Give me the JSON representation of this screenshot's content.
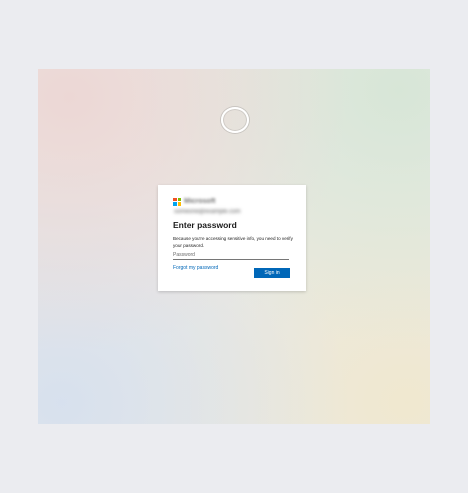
{
  "brand": {
    "name": "Microsoft",
    "logo_colors": [
      "#f25022",
      "#7fba00",
      "#00a4ef",
      "#ffb900"
    ]
  },
  "account": {
    "identity": "someone@example.com"
  },
  "dialog": {
    "title": "Enter password",
    "description": "Because you're accessing sensitive info, you need to verify your password.",
    "password_placeholder": "Password",
    "forgot_link": "Forgot my password",
    "signin_label": "Sign in"
  },
  "colors": {
    "accent": "#0067b8",
    "page_background": "#ebecf0",
    "card_background": "#ffffff"
  }
}
